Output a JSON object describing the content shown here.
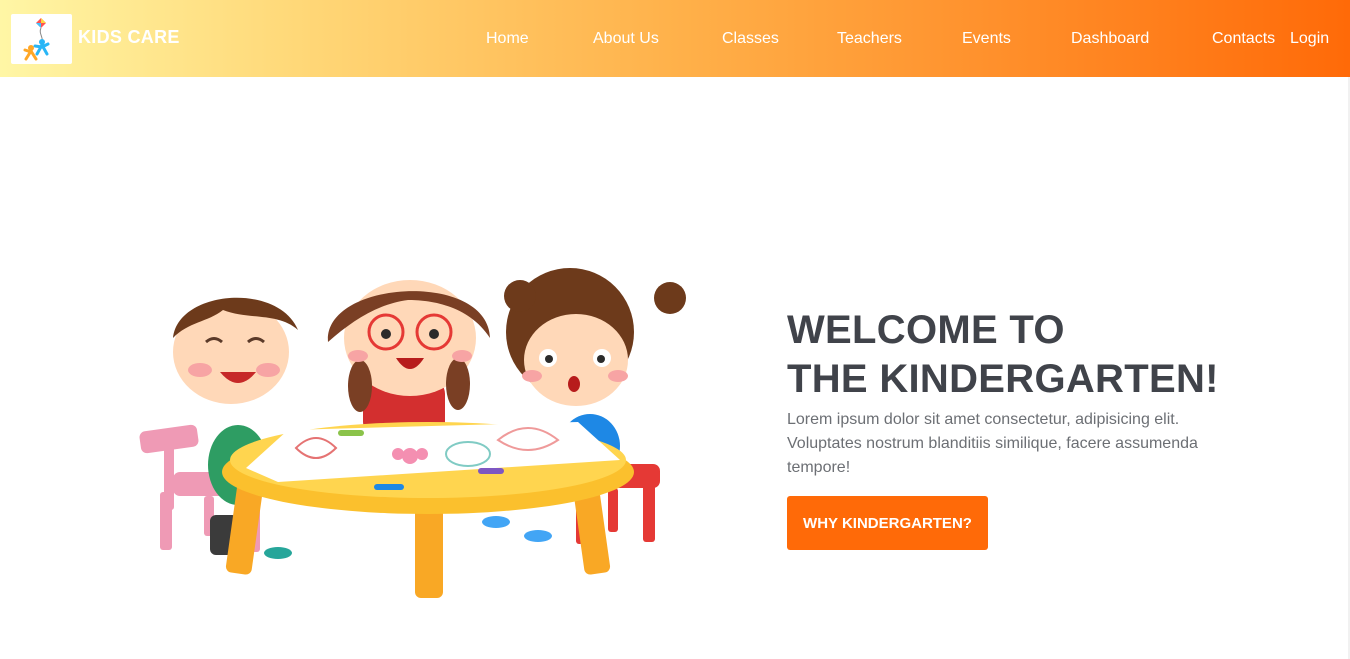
{
  "brand": {
    "name": "KIDS CARE"
  },
  "nav": {
    "home": "Home",
    "about": "About Us",
    "classes": "Classes",
    "teachers": "Teachers",
    "events": "Events",
    "dashboard": "Dashboard",
    "contacts": "Contacts",
    "login": "Login"
  },
  "hero": {
    "title_line1": "WELCOME TO",
    "title_line2": "THE KINDERGARTEN!",
    "description": "Lorem ipsum dolor sit amet consectetur, adipisicing elit. Voluptates nostrum blanditiis similique, facere assumenda tempore!",
    "cta_label": "WHY KINDERGARTEN?"
  },
  "colors": {
    "accent": "#ff6a08",
    "nav_gradient_start": "#fff6a5",
    "nav_gradient_end": "#ff6a08",
    "heading": "#40434a",
    "body_text": "#6c6f74"
  },
  "icons": {
    "logo": "kite-kids-logo-icon",
    "hero": "kids-drawing-at-table-illustration"
  }
}
